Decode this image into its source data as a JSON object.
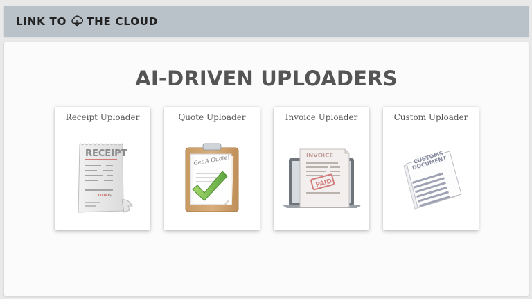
{
  "header": {
    "brand_part1": "LINK TO",
    "brand_part2": "THE CLOUD",
    "cloud_icon": "cloud-download-icon"
  },
  "main": {
    "title": "AI-DRIVEN UPLOADERS",
    "cards": [
      {
        "label": "Receipt Uploader",
        "icon": "receipt-icon",
        "art_text": {
          "receipt": "RECEIPT",
          "total": "TOTAL",
          "total_value": "$"
        }
      },
      {
        "label": "Quote Uploader",
        "icon": "clipboard-check-icon",
        "art_text": {
          "quote": "Get A Quote!"
        }
      },
      {
        "label": "Invoice Uploader",
        "icon": "invoice-laptop-icon",
        "art_text": {
          "invoice": "INVOICE",
          "paid": "PAID"
        }
      },
      {
        "label": "Custom Uploader",
        "icon": "customs-document-icon",
        "art_text": {
          "line1": "CUSTOMS",
          "line2": "DOCUMENT"
        }
      }
    ]
  },
  "colors": {
    "header_bg": "#b9c1c9",
    "title": "#555555",
    "check_green": "#7fbf5a",
    "paid_red": "#c44a4a"
  }
}
